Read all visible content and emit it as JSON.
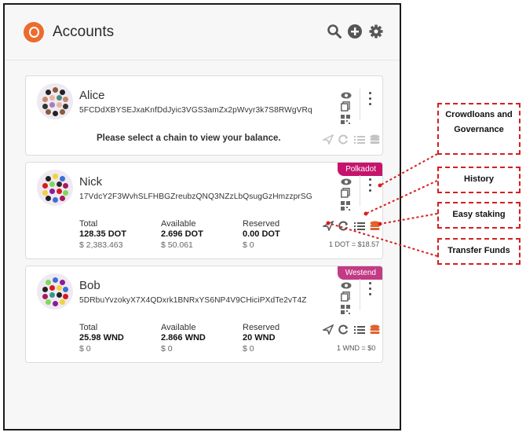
{
  "app": {
    "title": "Accounts"
  },
  "header_icons": [
    "search-icon",
    "add-icon",
    "gear-icon"
  ],
  "accounts": [
    {
      "name": "Alice",
      "address": "5FCDdXBYSEJxaKnfDdJyic3VGS3amZx2pWvyr3k7S8RWgVRq",
      "message": "Please select a chain to view your balance."
    },
    {
      "name": "Nick",
      "address": "17VdcY2F3WvhSLFHBGZreubzQNQ3NZzLbQsugGzHmzzprSG",
      "badge": "Polkadot",
      "total_label": "Total",
      "total": "128.35 DOT",
      "total_fiat": "$ 2,383.463",
      "available_label": "Available",
      "available": "2.696 DOT",
      "available_fiat": "$ 50.061",
      "reserved_label": "Reserved",
      "reserved": "0.00 DOT",
      "reserved_fiat": "$ 0",
      "rate": "1 DOT = $18.57"
    },
    {
      "name": "Bob",
      "address": "5DRbuYvzokyX7X4QDxrk1BNRxYS6NP4V9CHiciPXdTe2vT4Z",
      "badge": "Westend",
      "total_label": "Total",
      "total": "25.98 WND",
      "total_fiat": "$ 0",
      "available_label": "Available",
      "available": "2.866 WND",
      "available_fiat": "$ 0",
      "reserved_label": "Reserved",
      "reserved": "20 WND",
      "reserved_fiat": "$ 0",
      "rate": "1 WND = $0"
    }
  ],
  "annotations": {
    "crowdloans": "Crowdloans and Governance",
    "history": "History",
    "staking": "Easy staking",
    "transfer": "Transfer Funds"
  },
  "colors": {
    "polkadot": "#c5146d",
    "westend": "#c33b85",
    "logo": "#ec6b2d",
    "annotation": "#d42020"
  }
}
